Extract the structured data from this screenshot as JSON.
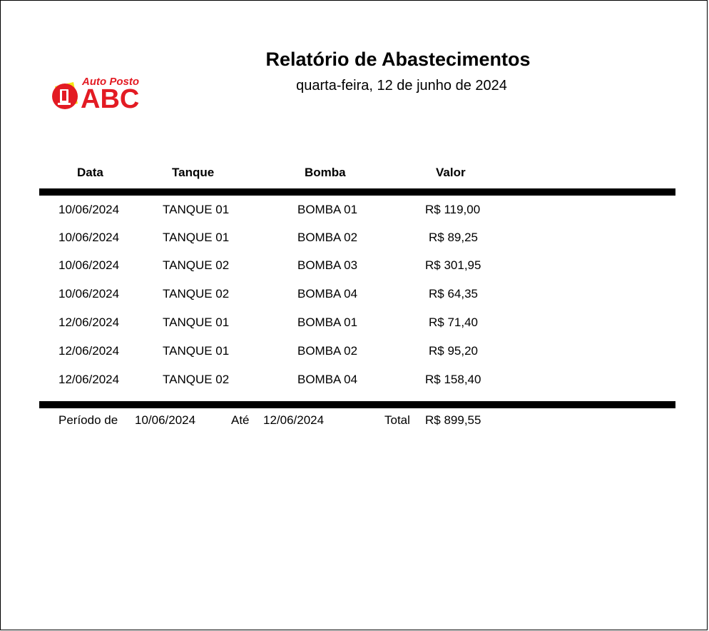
{
  "logo": {
    "line1": "Auto Posto",
    "line2": "ABC",
    "colors": {
      "red": "#e31b23",
      "yellow": "#f5e614"
    }
  },
  "report": {
    "title": "Relatório de Abastecimentos",
    "date": "quarta-feira, 12 de junho de 2024"
  },
  "table": {
    "headers": {
      "data": "Data",
      "tanque": "Tanque",
      "bomba": "Bomba",
      "valor": "Valor"
    },
    "rows": [
      {
        "data": "10/06/2024",
        "tanque": "TANQUE 01",
        "bomba": "BOMBA 01",
        "valor": "R$ 119,00"
      },
      {
        "data": "10/06/2024",
        "tanque": "TANQUE 01",
        "bomba": "BOMBA 02",
        "valor": "R$ 89,25"
      },
      {
        "data": "10/06/2024",
        "tanque": "TANQUE 02",
        "bomba": "BOMBA 03",
        "valor": "R$ 301,95"
      },
      {
        "data": "10/06/2024",
        "tanque": "TANQUE 02",
        "bomba": "BOMBA 04",
        "valor": "R$ 64,35"
      },
      {
        "data": "12/06/2024",
        "tanque": "TANQUE 01",
        "bomba": "BOMBA 01",
        "valor": "R$ 71,40"
      },
      {
        "data": "12/06/2024",
        "tanque": "TANQUE 01",
        "bomba": "BOMBA 02",
        "valor": "R$ 95,20"
      },
      {
        "data": "12/06/2024",
        "tanque": "TANQUE 02",
        "bomba": "BOMBA 04",
        "valor": "R$ 158,40"
      }
    ]
  },
  "footer": {
    "periodo_label": "Período de",
    "periodo_inicio": "10/06/2024",
    "ate_label": "Até",
    "periodo_fim": "12/06/2024",
    "total_label": "Total",
    "total_value": "R$ 899,55"
  }
}
